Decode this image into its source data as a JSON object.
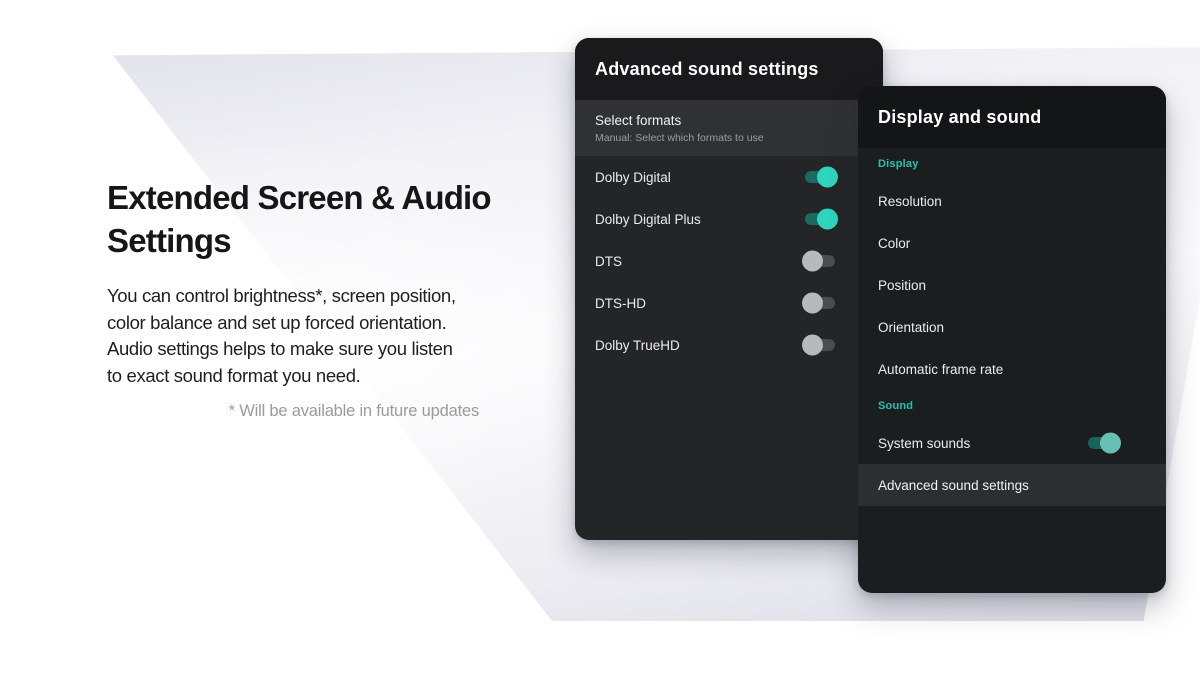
{
  "copy": {
    "heading": "Extended Screen & Audio Settings",
    "body_lines": [
      "You can control brightness*, screen position,",
      "color balance and set up forced orientation.",
      "Audio settings helps to make sure you listen",
      "to exact sound format you need."
    ],
    "footnote": "* Will be available in future updates"
  },
  "advanced_panel": {
    "title": "Advanced sound settings",
    "selected_item": {
      "title": "Select formats",
      "subtitle": "Manual: Select which formats to use"
    },
    "toggles": [
      {
        "label": "Dolby Digital",
        "state": "on"
      },
      {
        "label": "Dolby Digital Plus",
        "state": "on"
      },
      {
        "label": "DTS",
        "state": "off"
      },
      {
        "label": "DTS-HD",
        "state": "off"
      },
      {
        "label": "Dolby TrueHD",
        "state": "off"
      }
    ]
  },
  "display_panel": {
    "title": "Display and sound",
    "display_section": {
      "label": "Display",
      "items": [
        "Resolution",
        "Color",
        "Position",
        "Orientation",
        "Automatic frame rate"
      ]
    },
    "sound_section": {
      "label": "Sound",
      "toggle_item": {
        "label": "System sounds",
        "state": "on"
      },
      "selected_item": "Advanced sound settings"
    }
  },
  "colors": {
    "accent_teal": "#2bc0b4",
    "toggle_on_knob": "#2fd4bd",
    "toggle_on_track": "#1d6a60",
    "toggle_on_knob_dim": "#66c1b4",
    "toggle_off_knob": "#b7b9ba",
    "toggle_off_track": "#4b4e50",
    "panel_advanced_bg": "#232527",
    "panel_advanced_header_bg": "#1a1a1c",
    "panel_display_bg": "#1b1e1f",
    "panel_display_header_bg": "#141516",
    "highlight_row_bg": "#2f3133",
    "background": "#ffffff"
  }
}
